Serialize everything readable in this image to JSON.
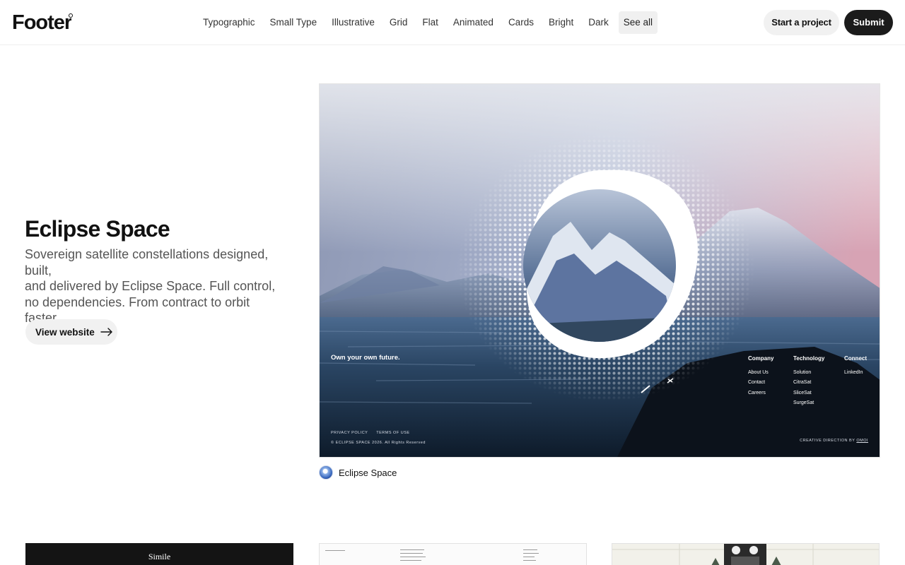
{
  "header": {
    "logo": "Footer",
    "nav": [
      "Typographic",
      "Small Type",
      "Illustrative",
      "Grid",
      "Flat",
      "Animated",
      "Cards",
      "Bright",
      "Dark",
      "See all"
    ],
    "active_nav": "See all",
    "project_button": "Start a project",
    "submit_button": "Submit"
  },
  "feature": {
    "title": "Eclipse Space",
    "description": [
      "Sovereign satellite constellations designed, built,",
      "and delivered by Eclipse Space. Full control,",
      "no dependencies. From contract to orbit faster."
    ],
    "view_button": "View website",
    "arrow_icon": "arrow-right-icon"
  },
  "preview": {
    "tagline": "Own your own future.",
    "columns": [
      {
        "heading": "Company",
        "links": [
          "About Us",
          "Contact",
          "Careers"
        ]
      },
      {
        "heading": "Technology",
        "links": [
          "Solution",
          "CitraSat",
          "SliceSat",
          "SurgeSat"
        ]
      },
      {
        "heading": "Connect",
        "links": [
          "LinkedIn"
        ]
      }
    ],
    "legal_links": [
      "PRIVACY POLICY",
      "TERMS OF USE"
    ],
    "copyright": "© ECLIPSE SPACE 2026. All Rights Reserved",
    "credit_prefix": "CREATIVE DIRECTION BY",
    "credit_name": "OMOI"
  },
  "caption": {
    "name": "Eclipse Space",
    "icon": "eclipse-logo-icon"
  },
  "thumbnails": [
    {
      "label": "Simile"
    },
    {
      "label": ""
    },
    {
      "label": ""
    }
  ],
  "colors": {
    "submit_bg": "#1b1b1b",
    "pill_bg": "#f1f1f1",
    "active_nav_bg": "#f0f0f0"
  }
}
